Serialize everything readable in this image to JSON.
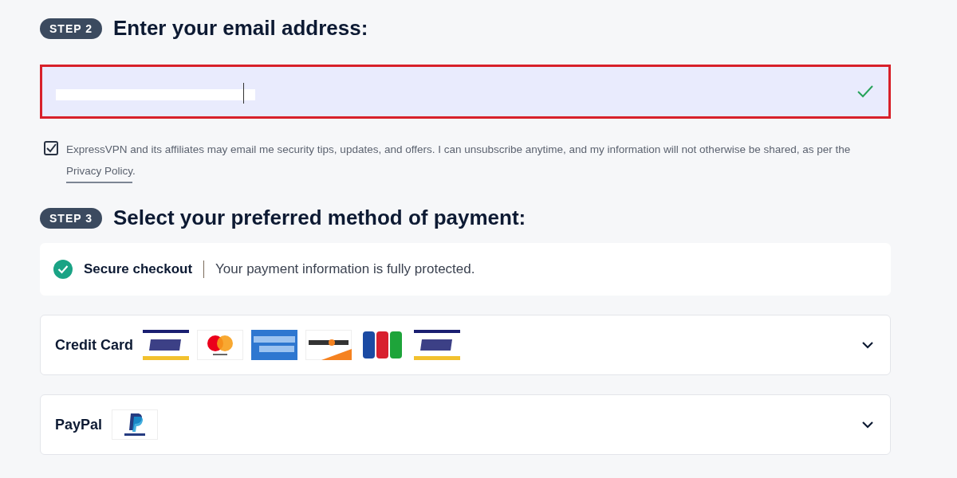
{
  "step2": {
    "badge": "STEP 2",
    "heading": "Enter your email address:",
    "email_field": {
      "valid": true
    },
    "consent": {
      "checked": true,
      "text": "ExpressVPN and its affiliates may email me security tips, updates, and offers. I can unsubscribe anytime, and my information will not otherwise be shared, as per the",
      "link": "Privacy Policy",
      "after": "."
    }
  },
  "step3": {
    "badge": "STEP 3",
    "heading": "Select your preferred method of payment:",
    "secure": {
      "title": "Secure checkout",
      "text": "Your payment information is fully protected."
    },
    "payment_methods": [
      {
        "label": "Credit Card",
        "expanded": false,
        "logos": [
          {
            "kind": "visa"
          },
          {
            "kind": "mastercard"
          },
          {
            "kind": "amex"
          },
          {
            "kind": "discover"
          },
          {
            "kind": "jcb"
          },
          {
            "kind": "visa-electron"
          }
        ]
      },
      {
        "label": "PayPal",
        "expanded": false,
        "logos": [
          {
            "kind": "paypal"
          }
        ]
      }
    ]
  }
}
